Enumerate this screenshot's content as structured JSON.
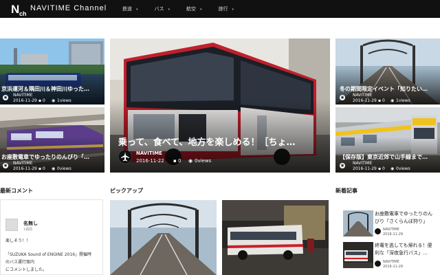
{
  "brand": {
    "name": "NAVITIME Channel"
  },
  "nav": [
    {
      "label": "鉄道"
    },
    {
      "label": "バス"
    },
    {
      "label": "航空"
    },
    {
      "label": "旅行"
    }
  ],
  "featured": {
    "main": {
      "title": "乗って、食べて、地方を楽しめる！［ちょ…",
      "source": "NAVITIME",
      "date": "2016-11-22",
      "comments": "0",
      "views": "0views"
    },
    "left_top": {
      "title": "京浜運河＆隅田川＆神田川ゆった…",
      "source": "NAVITIME",
      "date": "2016-11-29",
      "comments": "0",
      "views": "1views"
    },
    "left_bottom": {
      "title": "お座敷電車でゆったりのんびり「…",
      "source": "NAVITIME",
      "date": "2016-11-29",
      "comments": "0",
      "views": "0views"
    },
    "right_top": {
      "title": "冬の期間限定イベント「知りたい…",
      "source": "NAVITIME",
      "date": "2016-11-29",
      "comments": "0",
      "views": "1views"
    },
    "right_bottom": {
      "title": "【保存版】東京近郊で山手線まで…",
      "source": "NAVITIME",
      "date": "2016-11-29",
      "comments": "0",
      "views": "0views"
    }
  },
  "sections": {
    "comments_title": "最新コメント",
    "pickup_title": "ピックアップ",
    "new_title": "新着記事"
  },
  "comment": {
    "name": "名無し",
    "time": "1週前",
    "line1": "楽しそう！！",
    "line2": "「SUZUKA Sound of ENGINE 2016」開催時",
    "line3": "のバス運行案内",
    "line4": "にコメントしました。"
  },
  "new_articles": [
    {
      "title_line1": "お座敷電車でゆったりのん",
      "title_line2": "びり「さくらんぼ狩り」",
      "source": "NAVITIME",
      "date": "2016-11-29"
    },
    {
      "title_line1": "終電を逃しても帰れる！便",
      "title_line2": "利な「深夜急行バス」…",
      "source": "NAVITIME",
      "date": "2016-11-29"
    }
  ],
  "colors": {
    "topbar": "#111111",
    "bus_red": "#c8202a",
    "accent_yellow": "#f0c21e"
  }
}
